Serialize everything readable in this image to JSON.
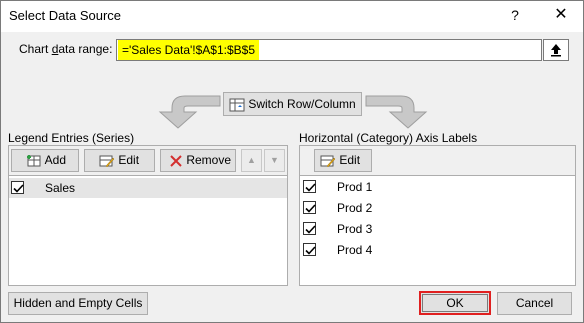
{
  "window": {
    "title": "Select Data Source",
    "help_label": "?",
    "close_label": "✕"
  },
  "range": {
    "label": "Chart data range:",
    "value": "='Sales Data'!$A$1:$B$5"
  },
  "switch_button": {
    "label": "Switch Row/Column"
  },
  "legend_group": {
    "label": "Legend Entries (Series)",
    "add_label": "Add",
    "edit_label": "Edit",
    "remove_label": "Remove",
    "up_label": "▲",
    "down_label": "▼",
    "series": [
      {
        "name": "Sales",
        "checked": true
      }
    ]
  },
  "axis_group": {
    "label": "Horizontal (Category) Axis Labels",
    "edit_label": "Edit",
    "items": [
      {
        "name": "Prod 1",
        "checked": true
      },
      {
        "name": "Prod 2",
        "checked": true
      },
      {
        "name": "Prod 3",
        "checked": true
      },
      {
        "name": "Prod 4",
        "checked": true
      }
    ]
  },
  "footer": {
    "hidden_cells_label": "Hidden and Empty Cells",
    "ok_label": "OK",
    "cancel_label": "Cancel"
  },
  "colors": {
    "highlight": "#ffff00",
    "ok_outline": "#e02020",
    "plus_green": "#2f9e44",
    "remove_red": "#d32f2f"
  }
}
